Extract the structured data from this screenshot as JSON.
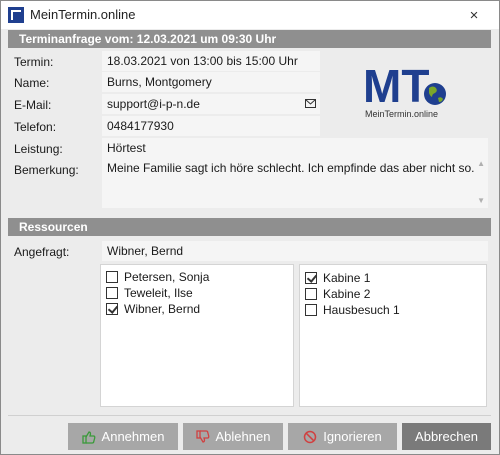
{
  "window": {
    "title": "MeinTermin.online",
    "close": "×"
  },
  "request": {
    "header": "Terminanfrage vom: 12.03.2021 um 09:30 Uhr",
    "fields": [
      {
        "label": "Termin:",
        "value": "18.03.2021 von 13:00 bis 15:00 Uhr"
      },
      {
        "label": "Name:",
        "value": "Burns, Montgomery"
      },
      {
        "label": "E-Mail:",
        "value": "support@i-p-n.de"
      },
      {
        "label": "Telefon:",
        "value": "0484177930"
      },
      {
        "label": "Leistung:",
        "value": "Hörtest"
      },
      {
        "label": "Bemerkung:",
        "value": "Meine Familie sagt ich höre schlecht. Ich empfinde das aber nicht so."
      }
    ]
  },
  "logo": {
    "text": "MT",
    "subtitle": "MeinTermin.online"
  },
  "resources": {
    "header": "Ressourcen",
    "requested_label": "Angefragt:",
    "requested_value": "Wibner, Bernd",
    "staff": [
      {
        "name": "Petersen, Sonja",
        "checked": false
      },
      {
        "name": "Teweleit, Ilse",
        "checked": false
      },
      {
        "name": "Wibner, Bernd",
        "checked": true
      }
    ],
    "rooms": [
      {
        "name": "Kabine 1",
        "checked": true
      },
      {
        "name": "Kabine 2",
        "checked": false
      },
      {
        "name": "Hausbesuch 1",
        "checked": false
      }
    ]
  },
  "buttons": {
    "accept": "Annehmen",
    "decline": "Ablehnen",
    "ignore": "Ignorieren",
    "cancel": "Abbrechen"
  },
  "colors": {
    "section_header": "#8f8f8f",
    "logo_blue": "#1f3f8f",
    "logo_green": "#7aa62a"
  }
}
